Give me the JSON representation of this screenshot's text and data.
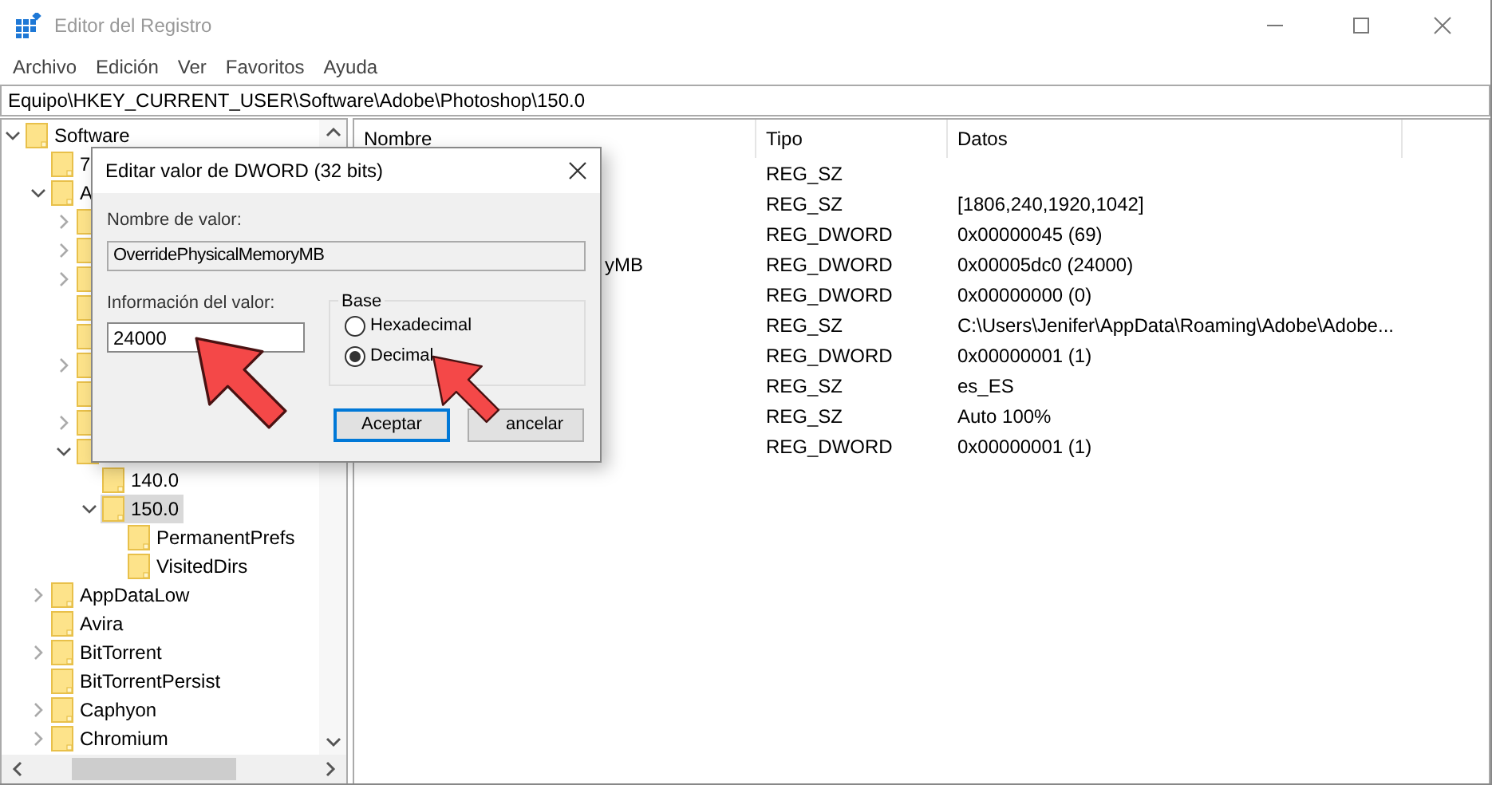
{
  "window": {
    "title": "Editor del Registro"
  },
  "menu": [
    "Archivo",
    "Edición",
    "Ver",
    "Favoritos",
    "Ayuda"
  ],
  "address": "Equipo\\HKEY_CURRENT_USER\\Software\\Adobe\\Photoshop\\150.0",
  "tree": [
    {
      "name": "Software",
      "expanded": true,
      "selected": false,
      "children": [
        {
          "name": "7",
          "selected": false
        },
        {
          "name": "A",
          "expanded": true,
          "selected": false,
          "children": [
            {
              "expanded": false,
              "selected": false
            },
            {
              "expanded": false,
              "selected": false
            },
            {
              "expanded": false,
              "selected": false
            },
            {
              "selected": false
            },
            {
              "selected": false
            },
            {
              "expanded": false,
              "selected": false
            },
            {
              "selected": false
            },
            {
              "expanded": false,
              "selected": false
            },
            {
              "expanded": true,
              "selected": false,
              "children": [
                {
                  "name": "140.0",
                  "selected": false
                },
                {
                  "name": "150.0",
                  "expanded": true,
                  "selected": true,
                  "children": [
                    {
                      "name": "PermanentPrefs",
                      "selected": false
                    },
                    {
                      "name": "VisitedDirs",
                      "selected": false
                    }
                  ]
                }
              ]
            }
          ]
        },
        {
          "name": "AppDataLow",
          "expanded": false,
          "selected": false
        },
        {
          "name": "Avira",
          "selected": false
        },
        {
          "name": "BitTorrent",
          "expanded": false,
          "selected": false
        },
        {
          "name": "BitTorrentPersist",
          "selected": false
        },
        {
          "name": "Caphyon",
          "expanded": false,
          "selected": false
        },
        {
          "name": "Chromium",
          "expanded": false,
          "selected": false
        }
      ]
    }
  ],
  "table": {
    "columns": [
      "Nombre",
      "Tipo",
      "Datos"
    ],
    "rows": [
      {
        "type": "REG_SZ"
      },
      {
        "type": "REG_SZ",
        "data": "[1806,240,1920,1042]"
      },
      {
        "type": "REG_DWORD",
        "data": "0x00000045 (69)"
      },
      {
        "name": "yMB",
        "type": "REG_DWORD",
        "data": "0x00005dc0 (24000)"
      },
      {
        "type": "REG_DWORD",
        "data": "0x00000000 (0)"
      },
      {
        "type": "REG_SZ",
        "data": "C:\\Users\\Jenifer\\AppData\\Roaming\\Adobe\\Adobe..."
      },
      {
        "type": "REG_DWORD",
        "data": "0x00000001 (1)"
      },
      {
        "type": "REG_SZ",
        "data": "es_ES"
      },
      {
        "type": "REG_SZ",
        "data": "Auto 100%"
      },
      {
        "type": "REG_DWORD",
        "data": "0x00000001 (1)"
      }
    ]
  },
  "dialog": {
    "title": "Editar valor de DWORD (32 bits)",
    "name_label": "Nombre de valor:",
    "name_value": "OverridePhysicalMemoryMB",
    "data_label": "Información del valor:",
    "data_value": "24000",
    "base_label": "Base",
    "base_options": [
      {
        "label": "Hexadecimal",
        "selected": false
      },
      {
        "label": "Decimal",
        "selected": true
      }
    ],
    "buttons": [
      {
        "label": "Aceptar",
        "selected": true
      },
      {
        "label": "ancelar",
        "selected": false
      }
    ]
  }
}
